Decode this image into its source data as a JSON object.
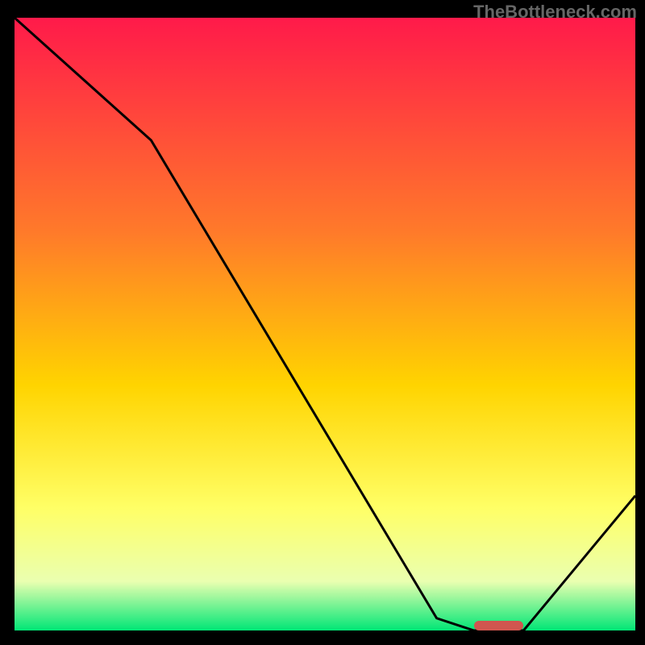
{
  "watermark": "TheBottleneck.com",
  "colors": {
    "bg_black": "#000000",
    "grad_top": "#ff1a4a",
    "grad_mid1": "#ff7a2a",
    "grad_mid2": "#ffd400",
    "grad_mid3": "#ffff66",
    "grad_mid4": "#eaffb0",
    "grad_bottom": "#00e676",
    "curve": "#000000",
    "marker": "#d0564f",
    "watermark_text": "#666666"
  },
  "chart_data": {
    "type": "line",
    "title": "",
    "xlabel": "",
    "ylabel": "",
    "xlim": [
      0,
      100
    ],
    "ylim": [
      0,
      100
    ],
    "series": [
      {
        "name": "bottleneck-curve",
        "x": [
          0,
          22,
          68,
          74,
          82,
          100
        ],
        "values": [
          100,
          80,
          2,
          0,
          0,
          22
        ]
      }
    ],
    "marker": {
      "x_start": 74,
      "x_end": 82,
      "y": 0
    },
    "gradient_stops": [
      {
        "offset": 0,
        "color": "#ff1a4a"
      },
      {
        "offset": 35,
        "color": "#ff7a2a"
      },
      {
        "offset": 60,
        "color": "#ffd400"
      },
      {
        "offset": 80,
        "color": "#ffff66"
      },
      {
        "offset": 92,
        "color": "#eaffb0"
      },
      {
        "offset": 100,
        "color": "#00e676"
      }
    ]
  }
}
